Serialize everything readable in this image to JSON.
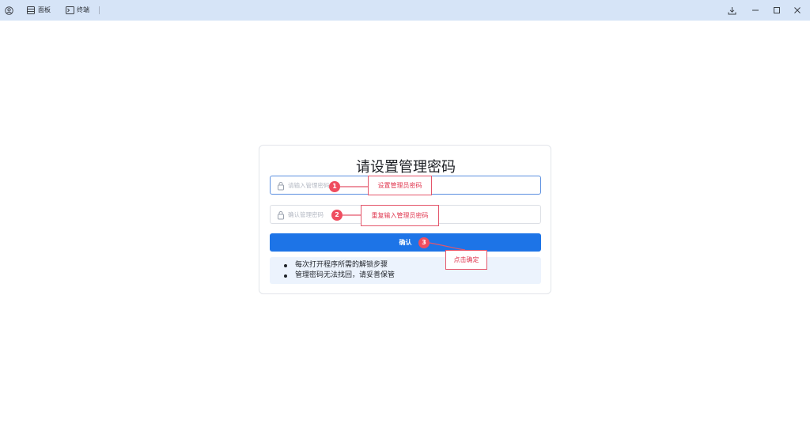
{
  "titlebar": {
    "tabs": [
      {
        "label": "面板",
        "icon": "panel-icon"
      },
      {
        "label": "终端",
        "icon": "terminal-icon"
      }
    ],
    "icons": [
      "user-icon",
      "download-icon",
      "minimize-icon",
      "maximize-icon",
      "close-icon"
    ]
  },
  "form": {
    "title": "请设置管理密码",
    "password_placeholder": "请输入管理密码",
    "confirm_placeholder": "确认管理密码",
    "confirm_button": "确认",
    "tips": [
      "每次打开程序所需的解锁步骤",
      "管理密码无法找回，请妥善保管"
    ]
  },
  "annotations": [
    {
      "number": "1",
      "text": "设置管理员密码"
    },
    {
      "number": "2",
      "text": "重复输入管理员密码"
    },
    {
      "number": "3",
      "text": "点击确定"
    }
  ],
  "colors": {
    "accent": "#1d74e7",
    "annotation": "#e4566b",
    "titlebar": "#d6e4f7"
  }
}
